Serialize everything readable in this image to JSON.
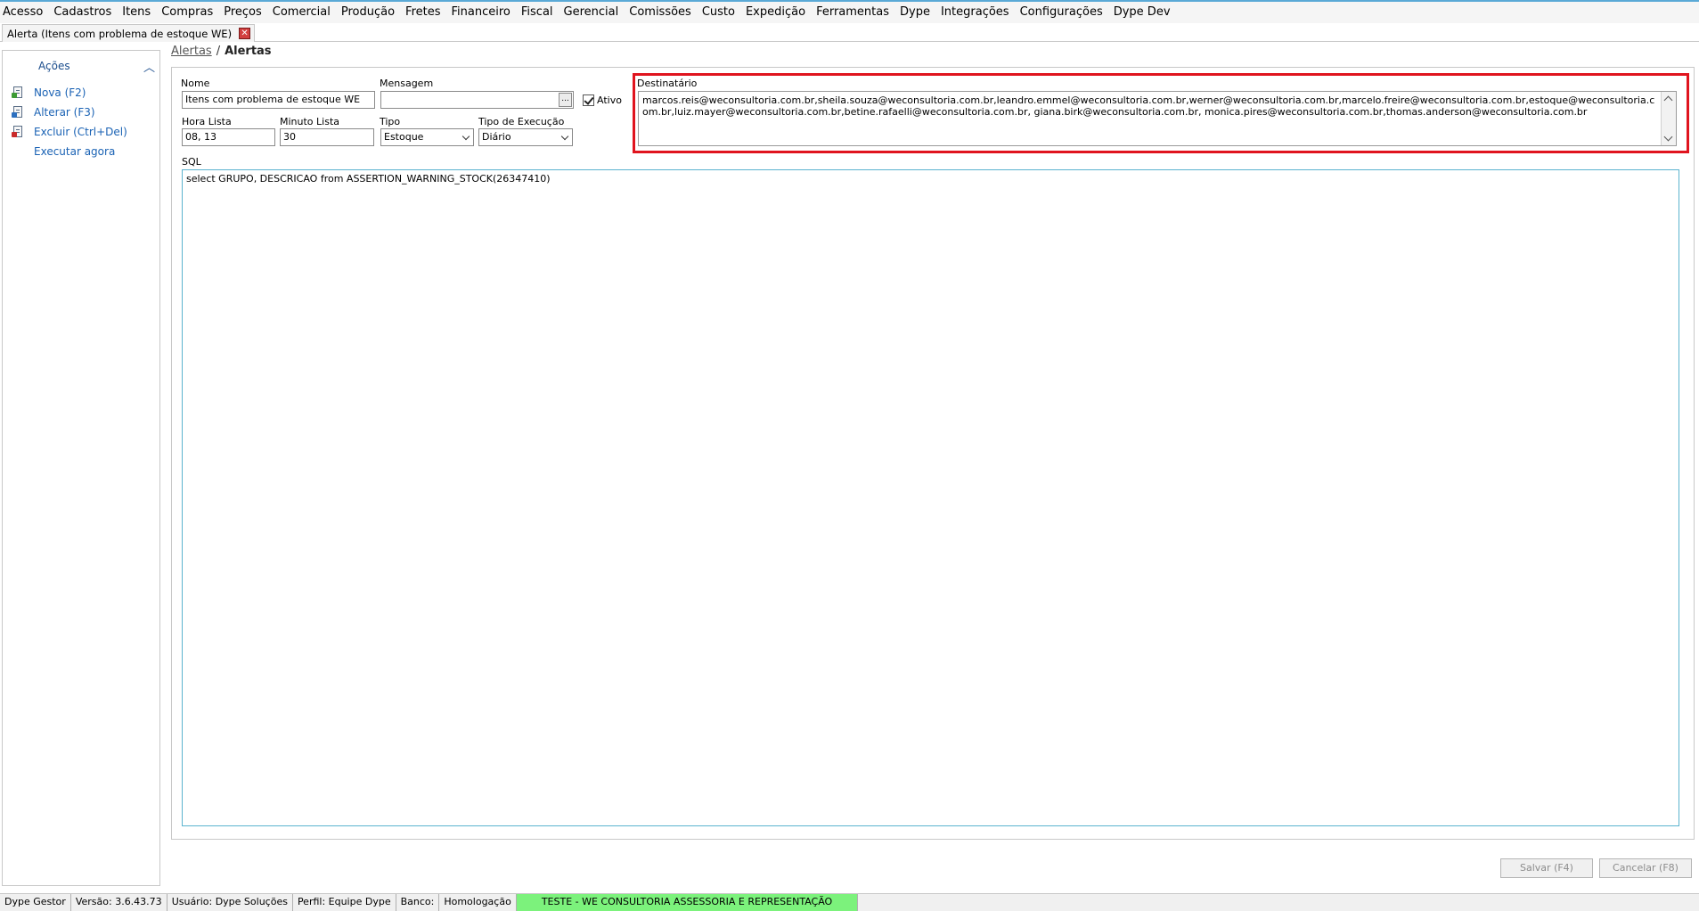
{
  "menu": {
    "items": [
      "Acesso",
      "Cadastros",
      "Itens",
      "Compras",
      "Preços",
      "Comercial",
      "Produção",
      "Fretes",
      "Financeiro",
      "Fiscal",
      "Gerencial",
      "Comissões",
      "Custo",
      "Expedição",
      "Ferramentas",
      "Dype",
      "Integrações",
      "Configurações",
      "Dype Dev"
    ]
  },
  "tab": {
    "title": "Alerta (Itens com problema de estoque WE)",
    "close_icon": "close-icon"
  },
  "actions": {
    "title": "Ações",
    "items": [
      {
        "label": "Nova (F2)",
        "icon": "new-document-icon"
      },
      {
        "label": "Alterar (F3)",
        "icon": "edit-document-icon"
      },
      {
        "label": "Excluir (Ctrl+Del)",
        "icon": "delete-document-icon"
      },
      {
        "label": "Executar agora",
        "icon": ""
      }
    ]
  },
  "breadcrumb": {
    "link": "Alertas",
    "separator": "/",
    "current": "Alertas"
  },
  "form": {
    "nome_label": "Nome",
    "nome_value": "Itens com problema de estoque WE",
    "mensagem_label": "Mensagem",
    "mensagem_value": "",
    "ellipsis_label": "...",
    "ativo_label": "Ativo",
    "ativo_checked": true,
    "hora_label": "Hora Lista",
    "hora_value": "08, 13",
    "minuto_label": "Minuto Lista",
    "minuto_value": "30",
    "tipo_label": "Tipo",
    "tipo_value": "Estoque",
    "tipo_exec_label": "Tipo de Execução",
    "tipo_exec_value": "Diário",
    "destinatario_label": "Destinatário",
    "destinatario_value": "marcos.reis@weconsultoria.com.br,sheila.souza@weconsultoria.com.br,leandro.emmel@weconsultoria.com.br,werner@weconsultoria.com.br,marcelo.freire@weconsultoria.com.br,estoque@weconsultoria.com.br,luiz.mayer@weconsultoria.com.br,betine.rafaelli@weconsultoria.com.br, giana.birk@weconsultoria.com.br, monica.pires@weconsultoria.com.br,thomas.anderson@weconsultoria.com.br",
    "sql_label": "SQL",
    "sql_value": "select GRUPO, DESCRICAO from ASSERTION_WARNING_STOCK(26347410)"
  },
  "buttons": {
    "save": "Salvar (F4)",
    "cancel": "Cancelar (F8)"
  },
  "status": {
    "app": "Dype Gestor",
    "version": "Versão: 3.6.43.73",
    "user": "Usuário: Dype Soluções",
    "profile": "Perfil: Equipe Dype",
    "bank_label": "Banco:",
    "bank_value": "Homologação",
    "environment": "TESTE - WE CONSULTORIA ASSESSORIA E REPRESENTAÇÃO"
  },
  "colors": {
    "highlight_frame": "#e0141e",
    "link_blue": "#1a62b4",
    "environment_green": "#7cf27c",
    "sql_border": "#5bb3cf"
  }
}
